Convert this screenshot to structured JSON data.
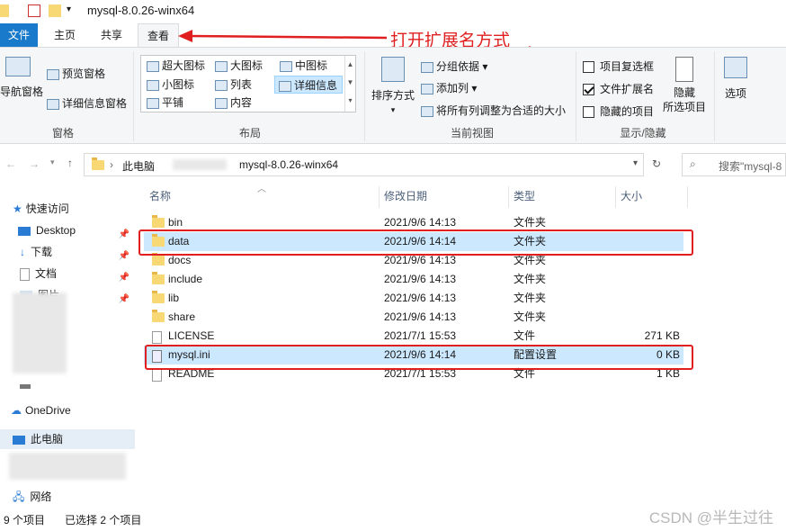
{
  "window": {
    "title": "mysql-8.0.26-winx64"
  },
  "tabs": [
    {
      "label": "文件"
    },
    {
      "label": "主页"
    },
    {
      "label": "共享"
    },
    {
      "label": "查看"
    }
  ],
  "annotation": "打开扩展名方式",
  "ribbon": {
    "panes": {
      "nav_pane": "导航窗格",
      "preview_pane": "预览窗格",
      "details_pane": "详细信息窗格",
      "group_label": "窗格"
    },
    "layout": {
      "items": [
        "超大图标",
        "大图标",
        "中图标",
        "小图标",
        "列表",
        "详细信息",
        "平铺",
        "内容"
      ],
      "selected": "详细信息",
      "group_label": "布局"
    },
    "current_view": {
      "sort_by": "排序方式",
      "group_by": "分组依据",
      "add_column": "添加列",
      "fit_columns": "将所有列调整为合适的大小",
      "group_label": "当前视图"
    },
    "show_hide": {
      "item_checkboxes": {
        "label": "项目复选框",
        "checked": false
      },
      "file_extensions": {
        "label": "文件扩展名",
        "checked": true
      },
      "hidden_items": {
        "label": "隐藏的项目",
        "checked": false
      },
      "hide_selected": "隐藏\n所选项目",
      "hide_label_1": "隐藏",
      "hide_label_2": "所选项目",
      "group_label": "显示/隐藏"
    },
    "options": "选项"
  },
  "address": {
    "root": "此电脑",
    "current": "mysql-8.0.26-winx64",
    "search_placeholder": "搜索\"mysql-8"
  },
  "nav": {
    "quick_access": "快速访问",
    "items": [
      "Desktop",
      "下载",
      "文档",
      "图片"
    ],
    "onedrive": "OneDrive",
    "this_pc": "此电脑",
    "network": "网络"
  },
  "columns": {
    "name": "名称",
    "date": "修改日期",
    "type": "类型",
    "size": "大小"
  },
  "files": [
    {
      "name": "bin",
      "date": "2021/9/6 14:13",
      "type": "文件夹",
      "size": "",
      "kind": "folder"
    },
    {
      "name": "data",
      "date": "2021/9/6 14:14",
      "type": "文件夹",
      "size": "",
      "kind": "folder"
    },
    {
      "name": "docs",
      "date": "2021/9/6 14:13",
      "type": "文件夹",
      "size": "",
      "kind": "folder"
    },
    {
      "name": "include",
      "date": "2021/9/6 14:13",
      "type": "文件夹",
      "size": "",
      "kind": "folder"
    },
    {
      "name": "lib",
      "date": "2021/9/6 14:13",
      "type": "文件夹",
      "size": "",
      "kind": "folder"
    },
    {
      "name": "share",
      "date": "2021/9/6 14:13",
      "type": "文件夹",
      "size": "",
      "kind": "folder"
    },
    {
      "name": "LICENSE",
      "date": "2021/7/1 15:53",
      "type": "文件",
      "size": "271 KB",
      "kind": "file"
    },
    {
      "name": "mysql.ini",
      "date": "2021/9/6 14:14",
      "type": "配置设置",
      "size": "0 KB",
      "kind": "config"
    },
    {
      "name": "README",
      "date": "2021/7/1 15:53",
      "type": "文件",
      "size": "1 KB",
      "kind": "file"
    }
  ],
  "status": {
    "count": "9 个项目",
    "selected": "已选择 2 个项目"
  },
  "watermark": "CSDN @半生过往"
}
